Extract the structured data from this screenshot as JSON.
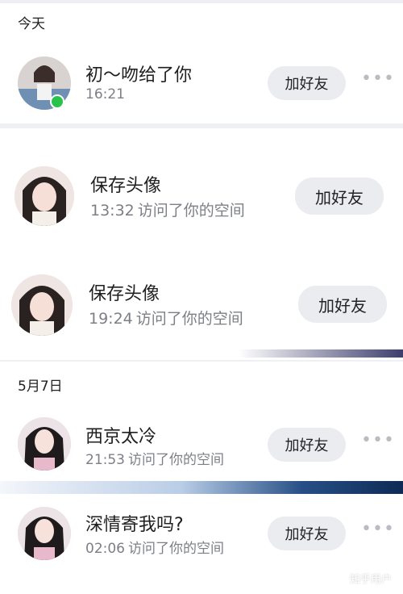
{
  "sections": {
    "today": "今天",
    "may7": "5月7日"
  },
  "rows": [
    {
      "name": "初～吻给了你",
      "time": "16:21",
      "action": ""
    },
    {
      "name": "保存头像",
      "time": "13:32",
      "action": "访问了你的空间"
    },
    {
      "name": "保存头像",
      "time": "19:24",
      "action": "访问了你的空间"
    },
    {
      "name": "西京太冷",
      "time": "21:53",
      "action": "访问了你的空间"
    },
    {
      "name": "深情寄我吗?",
      "time": "02:06",
      "action": "访问了你的空间"
    }
  ],
  "buttons": {
    "add_friend": "加好友"
  },
  "more_icon": "more-dots-icon",
  "watermark": "知乎用户",
  "colors": {
    "button_bg": "#ebecf0",
    "meta_text": "#7d7f86",
    "wechat_badge": "#29c24a"
  }
}
